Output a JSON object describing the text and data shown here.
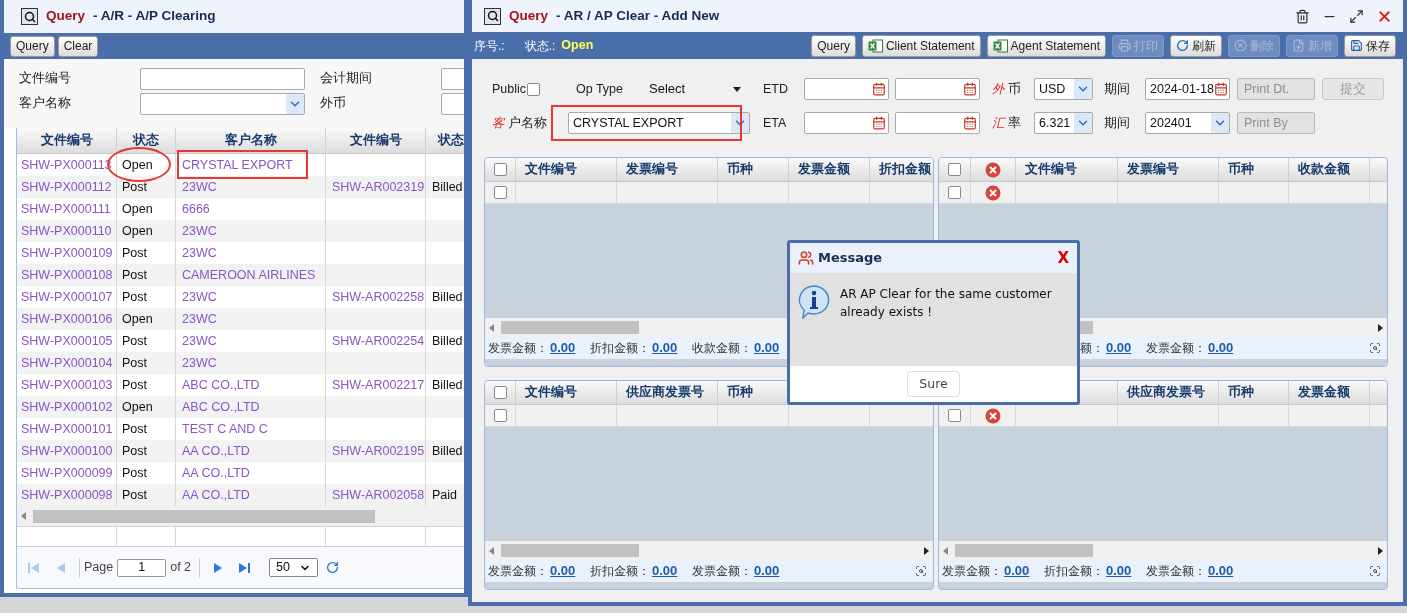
{
  "left_window": {
    "title_prefix": "Query",
    "title": "- A/R - A/P Clearing",
    "buttons": [
      "Query",
      "Clear"
    ],
    "filters": [
      {
        "label": "文件编号",
        "kind": "text"
      },
      {
        "label": "会计期间",
        "kind": "text"
      },
      {
        "label": "客户名称",
        "kind": "select"
      },
      {
        "label": "外币",
        "kind": "text"
      }
    ],
    "table": {
      "columns": [
        "文件编号",
        "状态",
        "客户名称",
        "文件编号",
        "状态"
      ],
      "rows": [
        {
          "doc": "SHW-PX000113",
          "status": "Open",
          "customer": "CRYSTAL EXPORT",
          "status_circled": true,
          "customer_boxed": true
        },
        {
          "doc": "SHW-PX000112",
          "status": "Post",
          "customer": "23WC",
          "ar_doc": "SHW-AR002319",
          "ar_status": "Billed",
          "status_circled": false,
          "customer_boxed": false
        },
        {
          "doc": "SHW-PX000111",
          "status": "Open",
          "customer": "6666",
          "status_circled": false,
          "customer_boxed": false
        },
        {
          "doc": "SHW-PX000110",
          "status": "Open",
          "customer": "23WC",
          "status_circled": false,
          "customer_boxed": false
        },
        {
          "doc": "SHW-PX000109",
          "status": "Post",
          "customer": "23WC",
          "status_circled": false,
          "customer_boxed": false
        },
        {
          "doc": "SHW-PX000108",
          "status": "Post",
          "customer": "CAMEROON AIRLINES",
          "status_circled": false,
          "customer_boxed": false
        },
        {
          "doc": "SHW-PX000107",
          "status": "Post",
          "customer": "23WC",
          "ar_doc": "SHW-AR002258",
          "ar_status": "Billed",
          "status_circled": false,
          "customer_boxed": false
        },
        {
          "doc": "SHW-PX000106",
          "status": "Open",
          "customer": "23WC",
          "status_circled": false,
          "customer_boxed": false
        },
        {
          "doc": "SHW-PX000105",
          "status": "Post",
          "customer": "23WC",
          "ar_doc": "SHW-AR002254",
          "ar_status": "Billed",
          "status_circled": false,
          "customer_boxed": false
        },
        {
          "doc": "SHW-PX000104",
          "status": "Post",
          "customer": "23WC",
          "status_circled": false,
          "customer_boxed": false
        },
        {
          "doc": "SHW-PX000103",
          "status": "Post",
          "customer": "ABC CO.,LTD",
          "ar_doc": "SHW-AR002217",
          "ar_status": "Billed",
          "status_circled": false,
          "customer_boxed": false
        },
        {
          "doc": "SHW-PX000102",
          "status": "Open",
          "customer": "ABC CO.,LTD",
          "status_circled": false,
          "customer_boxed": false
        },
        {
          "doc": "SHW-PX000101",
          "status": "Post",
          "customer": "TEST C AND C",
          "status_circled": false,
          "customer_boxed": false
        },
        {
          "doc": "SHW-PX000100",
          "status": "Post",
          "customer": "AA CO.,LTD",
          "ar_doc": "SHW-AR002195",
          "ar_status": "Billed",
          "status_circled": false,
          "customer_boxed": false
        },
        {
          "doc": "SHW-PX000099",
          "status": "Post",
          "customer": "AA CO.,LTD",
          "status_circled": false,
          "customer_boxed": false
        },
        {
          "doc": "SHW-PX000098",
          "status": "Post",
          "customer": "AA CO.,LTD",
          "ar_doc": "SHW-AR002058",
          "ar_status": "Paid",
          "status_circled": false,
          "customer_boxed": false
        }
      ]
    },
    "pager": {
      "label": "Page",
      "page": "1",
      "total": "of 2",
      "size": "50",
      "at_first": true,
      "at_last": false
    }
  },
  "right_window": {
    "title_prefix": "Query",
    "title": "- AR / AP Clear - Add New",
    "info": [
      {
        "label": "序号.:"
      },
      {
        "label": "状态.:",
        "value": "Open"
      }
    ],
    "buttons": [
      {
        "label": "Query",
        "kind": "plain",
        "disabled": false
      },
      {
        "label": "Client Statement",
        "kind": "excel",
        "disabled": false
      },
      {
        "label": "Agent Statement",
        "kind": "excel",
        "disabled": false
      },
      {
        "label": "打印",
        "kind": "print",
        "disabled": true
      },
      {
        "label": "刷新",
        "kind": "refresh",
        "disabled": false
      },
      {
        "label": "删除",
        "kind": "delete",
        "disabled": true
      },
      {
        "label": "新增",
        "kind": "add",
        "disabled": true
      },
      {
        "label": "保存",
        "kind": "save",
        "disabled": false
      }
    ],
    "form": {
      "public": {
        "label": "Public",
        "checked": false
      },
      "op_type": {
        "label": "Op Type",
        "value": "Select"
      },
      "etd": {
        "label": "ETD"
      },
      "eta": {
        "label": "ETA"
      },
      "currency": {
        "mark": "外",
        "label": "币",
        "value": "USD"
      },
      "rate": {
        "mark": "汇",
        "label": "率",
        "value": "6.321"
      },
      "period_date": {
        "label": "期间",
        "value": "2024-01-18"
      },
      "period": {
        "label": "期间",
        "value": "202401"
      },
      "print_date": {
        "placeholder": "Print Dt.",
        "disabled": true
      },
      "print_by": {
        "placeholder": "Print By",
        "disabled": true
      },
      "submit": {
        "label": "提交",
        "disabled": true
      },
      "customer": {
        "mark": "客",
        "label": "户名称",
        "value": "CRYSTAL EXPORT",
        "boxed": true
      }
    },
    "grids": [
      {
        "deletable": false,
        "header_checkbox": {
          "checked": false
        },
        "header_delete": false,
        "row_checkbox": {
          "checked": false
        },
        "columns": [
          {
            "kind": "text",
            "label": "文件编号"
          },
          {
            "kind": "text",
            "label": "发票编号"
          },
          {
            "kind": "text",
            "label": "币种"
          },
          {
            "kind": "text",
            "label": "发票金额"
          },
          {
            "kind": "text",
            "label": "折扣金额"
          }
        ],
        "totals": [
          {
            "kind": "text",
            "label": "发票金额：",
            "value": "0.00"
          },
          {
            "kind": "text",
            "label": "折扣金额：",
            "value": "0.00"
          },
          {
            "kind": "text",
            "label": "收款金额：",
            "value": "0.00"
          }
        ]
      },
      {
        "deletable": true,
        "header_checkbox": {
          "checked": false
        },
        "header_delete": true,
        "row_checkbox": {
          "checked": false
        },
        "columns": [
          {
            "kind": "text",
            "label": "文件编号"
          },
          {
            "kind": "text",
            "label": "发票编号"
          },
          {
            "kind": "text",
            "label": "币种"
          },
          {
            "kind": "text",
            "label": "收款金额"
          },
          {
            "kind": "hidden"
          }
        ],
        "totals": [
          {
            "kind": "hidden"
          },
          {
            "kind": "text",
            "label": "额：",
            "value": "0.00"
          },
          {
            "kind": "text",
            "label": "发票金额：",
            "value": "0.00"
          }
        ]
      },
      {
        "deletable": false,
        "header_checkbox": {
          "checked": false
        },
        "header_delete": false,
        "row_checkbox": {
          "checked": false
        },
        "columns": [
          {
            "kind": "text",
            "label": "文件编号"
          },
          {
            "kind": "text",
            "label": "供应商发票号"
          },
          {
            "kind": "text",
            "label": "币种"
          },
          {
            "kind": "hidden"
          },
          {
            "kind": "hidden"
          }
        ],
        "totals": [
          {
            "kind": "text",
            "label": "发票金额：",
            "value": "0.00"
          },
          {
            "kind": "text",
            "label": "折扣金额：",
            "value": "0.00"
          },
          {
            "kind": "text",
            "label": "发票金额：",
            "value": "0.00"
          }
        ]
      },
      {
        "deletable": true,
        "header_delete": false,
        "row_checkbox": {
          "checked": false
        },
        "columns": [
          {
            "kind": "hidden"
          },
          {
            "kind": "text",
            "label": "供应商发票号"
          },
          {
            "kind": "text",
            "label": "币种"
          },
          {
            "kind": "text",
            "label": "发票金额"
          },
          {
            "kind": "hidden"
          }
        ],
        "totals": [
          {
            "kind": "text",
            "label": "发票金额：",
            "value": "0.00"
          },
          {
            "kind": "text",
            "label": "折扣金额：",
            "value": "0.00"
          },
          {
            "kind": "text",
            "label": "发票金额：",
            "value": "0.00"
          }
        ]
      }
    ],
    "dialog": {
      "title": "Message",
      "close": "X",
      "message": "AR AP Clear for the same customer already exists !",
      "button": "Sure"
    }
  }
}
